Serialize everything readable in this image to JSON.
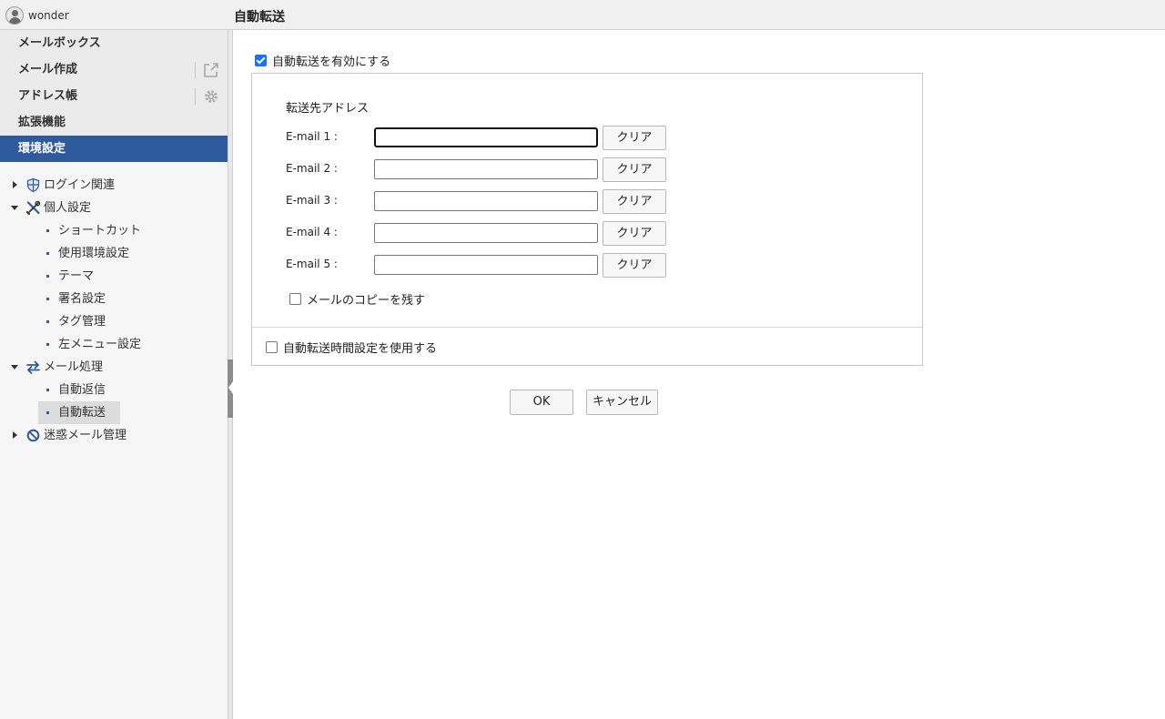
{
  "header": {
    "username": "wonder",
    "page_title": "自動転送"
  },
  "menu": {
    "items": [
      {
        "label": "メールボックス",
        "active": false
      },
      {
        "label": "メール作成",
        "active": false,
        "icon": "external-link-icon"
      },
      {
        "label": "アドレス帳",
        "active": false,
        "icon": "gear-icon"
      },
      {
        "label": "拡張機能",
        "active": false
      },
      {
        "label": "環境設定",
        "active": true
      }
    ]
  },
  "tree": {
    "login": {
      "label": "ログイン関連",
      "icon": "shield-icon",
      "expanded": false
    },
    "personal": {
      "label": "個人設定",
      "icon": "tools-icon",
      "expanded": true,
      "children": [
        "ショートカット",
        "使用環境設定",
        "テーマ",
        "署名設定",
        "タグ管理",
        "左メニュー設定"
      ]
    },
    "mail": {
      "label": "メール処理",
      "icon": "swap-arrows-icon",
      "expanded": true,
      "children": [
        "自動返信",
        "自動転送"
      ],
      "selected": "自動転送"
    },
    "spam": {
      "label": "迷惑メール管理",
      "icon": "block-icon",
      "expanded": false
    }
  },
  "form": {
    "enable_label": "自動転送を有効にする",
    "enable_checked": true,
    "section_label": "転送先アドレス",
    "emails": [
      {
        "label": "E-mail 1 :",
        "value": ""
      },
      {
        "label": "E-mail 2 :",
        "value": ""
      },
      {
        "label": "E-mail 3 :",
        "value": ""
      },
      {
        "label": "E-mail 4 :",
        "value": ""
      },
      {
        "label": "E-mail 5 :",
        "value": ""
      }
    ],
    "clear_label": "クリア",
    "keep_copy_label": "メールのコピーを残す",
    "keep_copy_checked": false,
    "schedule_label": "自動転送時間設定を使用する",
    "schedule_checked": false
  },
  "actions": {
    "ok_label": "OK",
    "cancel_label": "キャンセル"
  },
  "colors": {
    "accent": "#2f5a9e",
    "checkbox": "#1a73e8"
  }
}
